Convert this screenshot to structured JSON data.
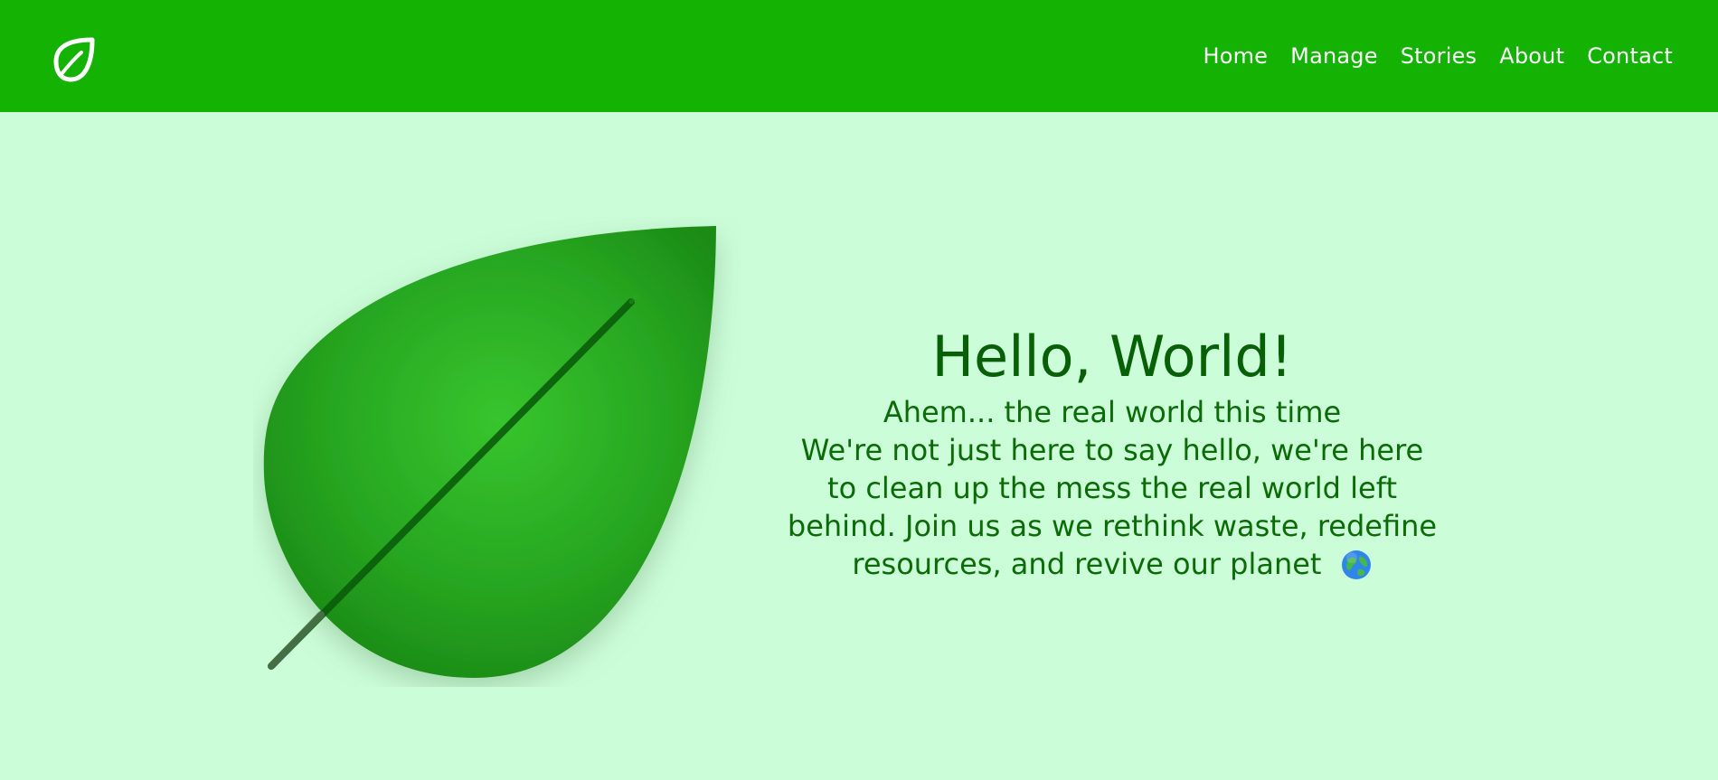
{
  "header": {
    "logo_icon": "leaf-logo-icon",
    "bar_color": "#13b203",
    "nav": [
      {
        "label": "Home"
      },
      {
        "label": "Manage"
      },
      {
        "label": "Stories"
      },
      {
        "label": "About"
      },
      {
        "label": "Contact"
      }
    ]
  },
  "hero": {
    "title": "Hello, World!",
    "subtitle": "Ahem... the real world this time",
    "body": "We're not just here to say hello, we're here to clean up the mess the real world left behind. Join us as we rethink waste, redefine resources, and revive our planet",
    "globe_icon": "globe-icon",
    "illustration_icon": "large-leaf-illustration"
  },
  "colors": {
    "background": "#ccfdd9",
    "text": "#0b6b07",
    "leaf": "#2aa822"
  }
}
